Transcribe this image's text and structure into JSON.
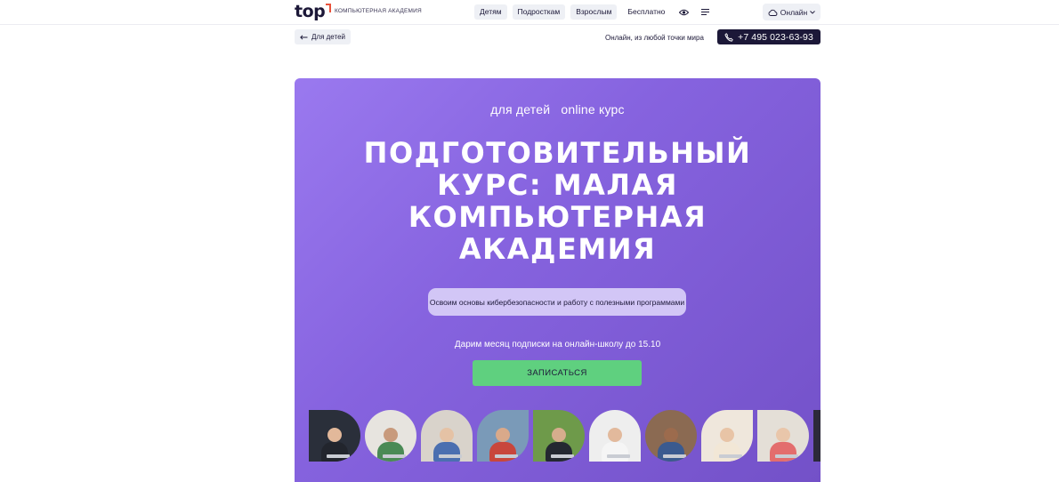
{
  "header": {
    "logo_text": "top",
    "logo_tagline": "КОМПЬЮТЕРНАЯ АКАДЕМИЯ",
    "nav": [
      {
        "label": "Детям",
        "filled": true
      },
      {
        "label": "Подросткам",
        "filled": true
      },
      {
        "label": "Взрослым",
        "filled": true
      },
      {
        "label": "Бесплатно",
        "filled": false
      }
    ],
    "icons": [
      "eye-icon",
      "menu-icon"
    ],
    "location_label": "Онлайн"
  },
  "subbar": {
    "back_label": "Для детей",
    "online_note": "Онлайн, из любой точки мира",
    "phone": "+7 495 023-63-93"
  },
  "hero": {
    "tag_audience": "для детей",
    "tag_format": "online курс",
    "title": "Подготовительный курс: Малая компьютерная академия",
    "subtitle": "Освоим основы кибербезопасности и работу с полезными программами",
    "promo": "Дарим месяц подписки на онлайн-школу до 15.10",
    "cta_label": "ЗАПИСАТЬСЯ"
  },
  "photos": [
    {
      "shape": "D-right",
      "bg": "#2a2f3a",
      "skin": "#e2b89a",
      "shirt": "#22252d"
    },
    {
      "shape": "circle",
      "bg": "#e7e4df",
      "skin": "#c89a7c",
      "shirt": "#4a8a55"
    },
    {
      "shape": "round-top",
      "bg": "#d9d3cb",
      "skin": "#e5c2a5",
      "shirt": "#4b6fb0"
    },
    {
      "shape": "leaf",
      "bg": "#7a9ab8",
      "skin": "#d9a98a",
      "shirt": "#c8463c"
    },
    {
      "shape": "D-right",
      "bg": "#6e9a4a",
      "skin": "#d6ad8d",
      "shirt": "#242831"
    },
    {
      "shape": "round-top",
      "bg": "#eeeeee",
      "skin": "#e2b99c",
      "shirt": "#f5f5f5"
    },
    {
      "shape": "circle",
      "bg": "#8b6a52",
      "skin": "#9c6b4d",
      "shirt": "#3a5a8f"
    },
    {
      "shape": "leaf",
      "bg": "#efe7dc",
      "skin": "#e8c4a6",
      "shirt": "#f2e7d6"
    },
    {
      "shape": "D-right",
      "bg": "#e4dfd7",
      "skin": "#e9c6aa",
      "shirt": "#e36d6d"
    },
    {
      "shape": "partial",
      "bg": "#2c2a3a",
      "skin": "#d4a98c",
      "shirt": "#3b3f52"
    }
  ]
}
